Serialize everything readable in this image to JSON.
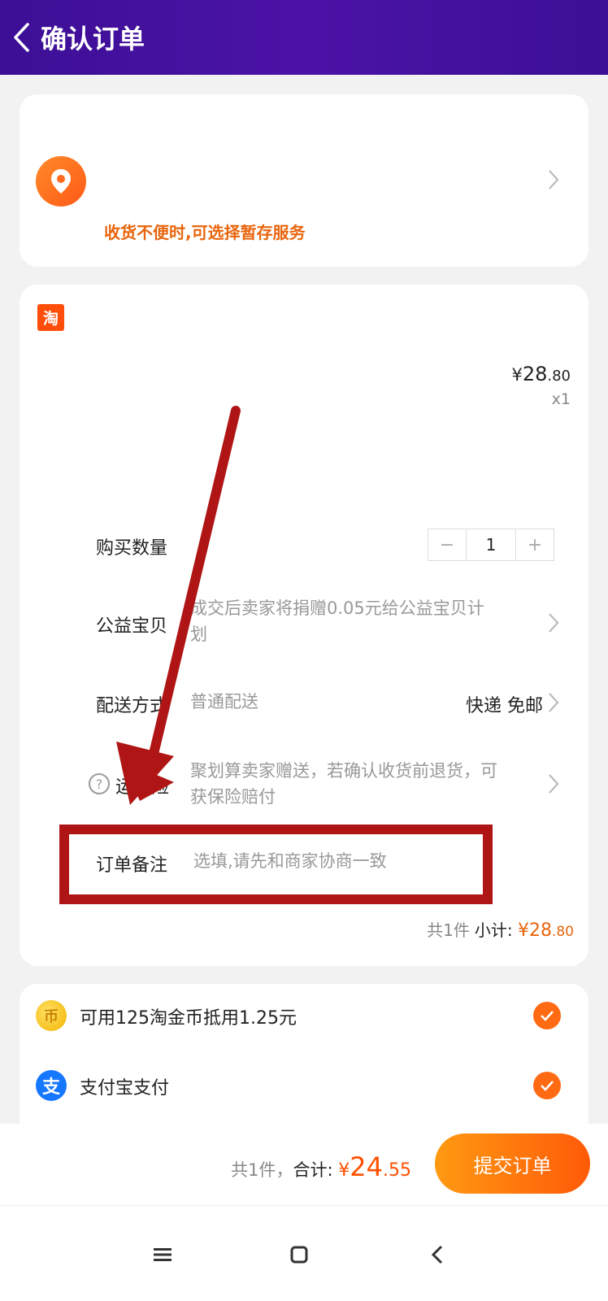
{
  "header": {
    "title": "确认订单"
  },
  "address": {
    "tip": "收货不便时,可选择暂存服务"
  },
  "shop": {
    "badge": "淘"
  },
  "item": {
    "price_sym": "¥",
    "price_int": "28",
    "price_dec": ".80",
    "qty_label": "x1"
  },
  "rows": {
    "quantity": {
      "label": "购买数量",
      "value": "1",
      "minus": "−",
      "plus": "+"
    },
    "charity": {
      "label": "公益宝贝",
      "value_line1": "成交后卖家将捐赠0.05元给公益宝贝计",
      "value_line2": "划"
    },
    "delivery": {
      "label": "配送方式",
      "value": "普通配送",
      "right": "快递 免邮"
    },
    "insurance": {
      "label": "运费险",
      "value_line1": "聚划算卖家赠送，若确认收货前退货，可",
      "value_line2": "获保险赔付"
    },
    "remark": {
      "label": "订单备注",
      "placeholder": "选填,请先和商家协商一致"
    }
  },
  "subtotal": {
    "count": "共1件",
    "label": "小计:",
    "sym": "¥",
    "int": "28",
    "dec": ".80"
  },
  "payment": {
    "coins": {
      "text": "可用125淘金币抵用1.25元"
    },
    "alipay": {
      "text": "支付宝支付"
    }
  },
  "footer": {
    "count": "共1件，",
    "label": "合计:",
    "sym": "¥",
    "int": "24",
    "dec": ".55",
    "submit": "提交订单"
  },
  "colors": {
    "header": "#4010a0",
    "accent": "#ff5a08",
    "annotation": "#b01515"
  }
}
